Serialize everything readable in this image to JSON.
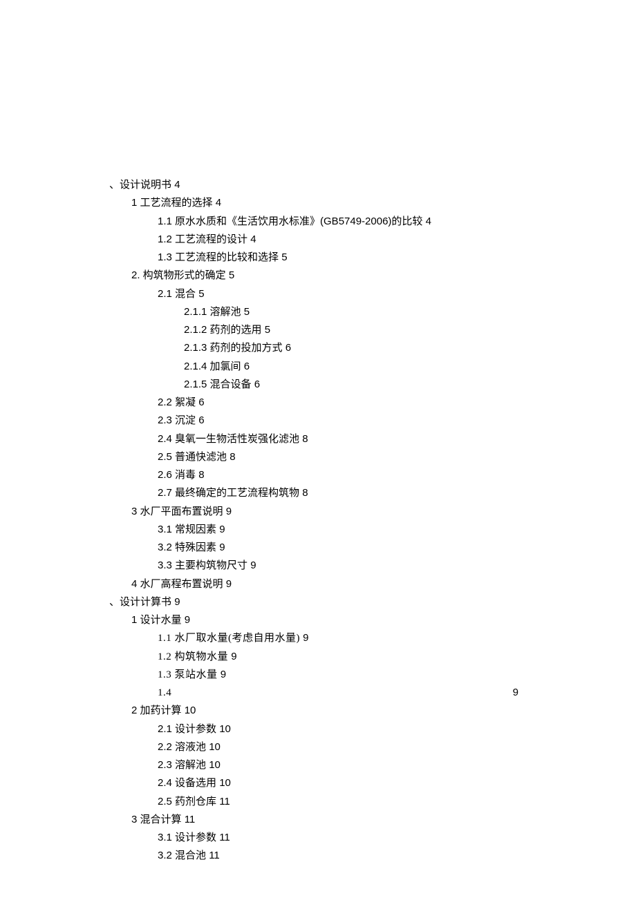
{
  "toc": [
    {
      "level": 0,
      "label": "、设计说明书",
      "page": "4",
      "align_right": false
    },
    {
      "level": 1,
      "label": "1 工艺流程的选择",
      "page": "4",
      "align_right": false
    },
    {
      "level": 2,
      "label": "1.1  原水水质和《生活饮用水标准》(GB5749-2006)的比较",
      "page": "4",
      "align_right": false
    },
    {
      "level": 2,
      "label": "1.2  工艺流程的设计",
      "page": "4",
      "align_right": false
    },
    {
      "level": 2,
      "label": "1.3  工艺流程的比较和选择",
      "page": "5",
      "align_right": false
    },
    {
      "level": 1,
      "label": "2. 构筑物形式的确定",
      "page": "5",
      "align_right": false
    },
    {
      "level": 2,
      "label": "2.1  混合",
      "page": "5",
      "align_right": false
    },
    {
      "level": 3,
      "label": "2.1.1  溶解池",
      "page": "5",
      "align_right": false
    },
    {
      "level": 3,
      "label": "2.1.2  药剂的选用",
      "page": "5",
      "align_right": false
    },
    {
      "level": 3,
      "label": "2.1.3  药剂的投加方式",
      "page": "6",
      "align_right": false
    },
    {
      "level": 3,
      "label": "2.1.4  加氯间",
      "page": "6",
      "align_right": false
    },
    {
      "level": 3,
      "label": "2.1.5  混合设备",
      "page": "6",
      "align_right": false
    },
    {
      "level": 2,
      "label": "2.2  絮凝",
      "page": "6",
      "align_right": false
    },
    {
      "level": 2,
      "label": "2.3  沉淀",
      "page": "6",
      "align_right": false
    },
    {
      "level": 2,
      "label": "2.4  臭氧一生物活性炭强化滤池",
      "page": "8",
      "align_right": false
    },
    {
      "level": 2,
      "label": "2.5  普通快滤池",
      "page": "8",
      "align_right": false
    },
    {
      "level": 2,
      "label": "2.6  消毒",
      "page": "8",
      "align_right": false
    },
    {
      "level": 2,
      "label": "2.7  最终确定的工艺流程构筑物",
      "page": "8",
      "align_right": false
    },
    {
      "level": 1,
      "label": "3 水厂平面布置说明",
      "page": "9",
      "align_right": false
    },
    {
      "level": 2,
      "label": "3.1  常规因素",
      "page": "9",
      "align_right": false
    },
    {
      "level": 2,
      "label": "3.2  特殊因素",
      "page": "9",
      "align_right": false
    },
    {
      "level": 2,
      "label": "3.3  主要构筑物尺寸",
      "page": "9",
      "align_right": false
    },
    {
      "level": 1,
      "label": "4 水厂高程布置说明",
      "page": "9",
      "align_right": false
    },
    {
      "level": 0,
      "label": "、设计计算书",
      "page": "9",
      "align_right": false
    },
    {
      "level": 1,
      "label": "1 设计水量",
      "page": "9",
      "align_right": false
    },
    {
      "level": 2,
      "label": "1.1 水厂取水量(考虑自用水量)",
      "page": "9",
      "align_right": false,
      "mono": true
    },
    {
      "level": 2,
      "label": "1.2 构筑物水量",
      "page": "9",
      "align_right": false,
      "mono": true
    },
    {
      "level": 2,
      "label": "1.3 泵站水量",
      "page": "9",
      "align_right": false,
      "mono": true
    },
    {
      "level": 2,
      "label": "1.4",
      "page": "9",
      "align_right": true,
      "mono": true
    },
    {
      "level": 1,
      "label": "2 加药计算",
      "page": "10",
      "align_right": false
    },
    {
      "level": 2,
      "label": "2.1  设计参数",
      "page": "10",
      "align_right": false
    },
    {
      "level": 2,
      "label": "2.2  溶液池",
      "page": "10",
      "align_right": false
    },
    {
      "level": 2,
      "label": "2.3  溶解池",
      "page": "10",
      "align_right": false
    },
    {
      "level": 2,
      "label": "2.4  设备选用",
      "page": "10",
      "align_right": false
    },
    {
      "level": 2,
      "label": "2.5  药剂仓库",
      "page": "11",
      "align_right": false
    },
    {
      "level": 1,
      "label": "3 混合计算",
      "page": "11",
      "align_right": false
    },
    {
      "level": 2,
      "label": "3.1  设计参数",
      "page": "11",
      "align_right": false
    },
    {
      "level": 2,
      "label": "3.2  混合池",
      "page": "11",
      "align_right": false
    }
  ]
}
